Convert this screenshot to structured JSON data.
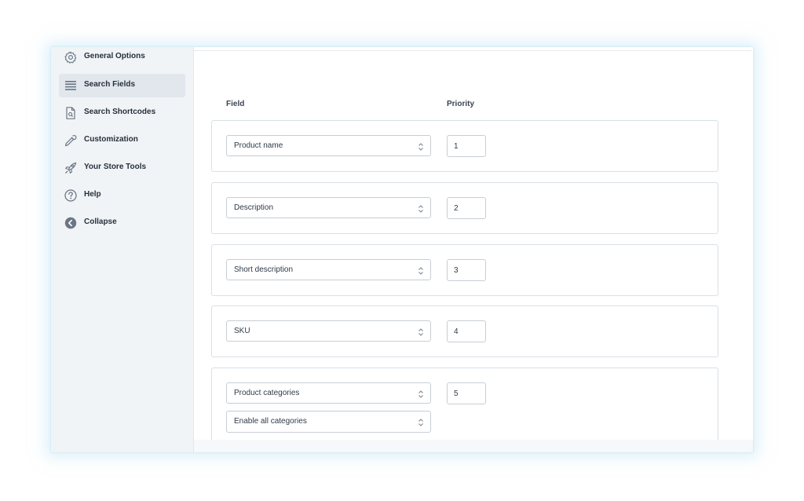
{
  "sidebar": {
    "items": [
      {
        "label": "General Options",
        "icon": "gear-icon",
        "active": false
      },
      {
        "label": "Search Fields",
        "icon": "list-icon",
        "active": true
      },
      {
        "label": "Search Shortcodes",
        "icon": "file-search-icon",
        "active": false
      },
      {
        "label": "Customization",
        "icon": "eyedropper-icon",
        "active": false
      },
      {
        "label": "Your Store Tools",
        "icon": "rocket-icon",
        "active": false
      },
      {
        "label": "Help",
        "icon": "help-circle-icon",
        "active": false
      },
      {
        "label": "Collapse",
        "icon": "collapse-arrow-icon",
        "active": false
      }
    ]
  },
  "table": {
    "field_header": "Field",
    "priority_header": "Priority",
    "rows": [
      {
        "field": "Product name",
        "priority": "1"
      },
      {
        "field": "Description",
        "priority": "2"
      },
      {
        "field": "Short description",
        "priority": "3"
      },
      {
        "field": "SKU",
        "priority": "4"
      },
      {
        "field": "Product categories",
        "sub_field": "Enable all categories",
        "priority": "5"
      }
    ]
  },
  "colors": {
    "sidebar_bg": "#f0f4f7",
    "active_item_bg": "#e1e7ed",
    "border": "#d8e0e6",
    "glow": "#bee4f2"
  }
}
